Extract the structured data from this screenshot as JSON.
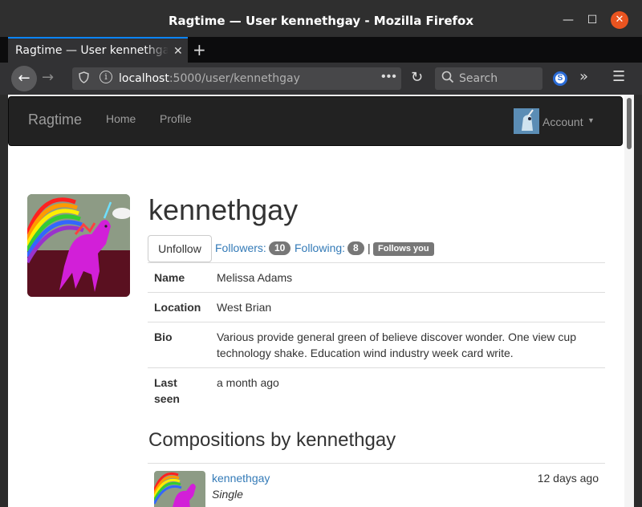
{
  "window": {
    "title": "Ragtime — User kennethgay - Mozilla Firefox",
    "minimize_icon": "minimize-icon",
    "maximize_icon": "maximize-icon",
    "close_icon": "close-icon"
  },
  "tabs": [
    {
      "label": "Ragtime — User kennethgay",
      "active": true
    }
  ],
  "toolbar": {
    "url_host": "localhost",
    "url_rest": ":5000/user/kennethgay",
    "search_placeholder": "Search"
  },
  "app": {
    "brand": "Ragtime",
    "nav": [
      "Home",
      "Profile"
    ],
    "account_label": "Account"
  },
  "profile": {
    "username": "kennethgay",
    "unfollow_label": "Unfollow",
    "followers_label": "Followers:",
    "followers_count": "10",
    "following_label": "Following:",
    "following_count": "8",
    "separator": "|",
    "follows_you_label": "Follows you",
    "fields": [
      {
        "key": "Name",
        "value": "Melissa Adams"
      },
      {
        "key": "Location",
        "value": "West Brian"
      },
      {
        "key": "Bio",
        "value": "Various provide general green of believe discover wonder. One view cup technology shake. Education wind industry week card write."
      },
      {
        "key": "Last seen",
        "value": "a month ago"
      }
    ]
  },
  "compositions": {
    "title": "Compositions by kennethgay",
    "items": [
      {
        "user": "kennethgay",
        "type": "Single",
        "time": "12 days ago"
      }
    ]
  },
  "colors": {
    "link": "#337ab7",
    "navbar_bg": "#222222",
    "badge": "#777777",
    "firefox_accent": "#0a84ff",
    "close_button": "#e95420"
  }
}
